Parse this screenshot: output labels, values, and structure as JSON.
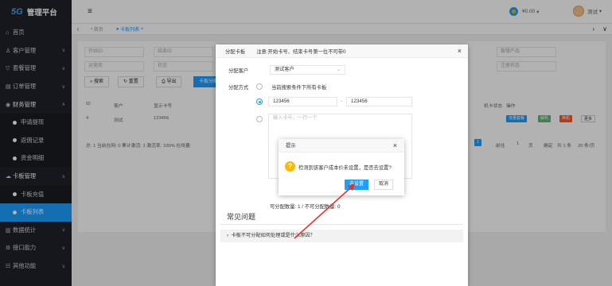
{
  "app": {
    "logo_mark": "5G",
    "title": "管理平台"
  },
  "sidebar": {
    "items": [
      {
        "icon": "home-icon",
        "label": "首页"
      },
      {
        "icon": "customer-icon",
        "label": "客户管理"
      },
      {
        "icon": "cart-icon",
        "label": "套餐管理"
      },
      {
        "icon": "order-icon",
        "label": "订单管理"
      },
      {
        "icon": "finance-icon",
        "label": "财务管理",
        "sub": [
          "申请提现",
          "返佣记录",
          "资金明细"
        ]
      },
      {
        "icon": "card-icon",
        "label": "卡板管理",
        "sub": [
          "卡板充值",
          "卡板列表"
        ]
      },
      {
        "icon": "stats-icon",
        "label": "数据统计"
      },
      {
        "icon": "api-icon",
        "label": "接口能力"
      },
      {
        "icon": "other-icon",
        "label": "其他功能"
      }
    ]
  },
  "header": {
    "menu_icon": "≡",
    "balance": "¥0.00",
    "balance_caret": "▾",
    "user": "测试",
    "user_caret": "▾"
  },
  "tabs": {
    "home": "首页",
    "current": "卡板列表"
  },
  "filters": {
    "row1": [
      "开始ID",
      "结束ID",
      "套餐产品",
      "注册状态"
    ],
    "row2": [
      "运营商",
      "状态"
    ],
    "search": "搜索",
    "reset": "重置",
    "export": "导出",
    "assign": "卡板分配"
  },
  "table": {
    "headers": [
      "ID",
      "客户",
      "显示卡号",
      "机卡状态",
      "操作"
    ],
    "row": {
      "id": "4",
      "customer": "测试",
      "card": "123456",
      "ops": [
        "流量套餐",
        "解机",
        "换机",
        "更多"
      ]
    }
  },
  "pager": {
    "text": "总: 1  当前在网: 0  累计激活: 1  激活率: 100%  在线量: ",
    "page": "1",
    "goto": "前往",
    "page_input": "1",
    "page_unit": "页",
    "confirm": "确定",
    "total": "共 1 条",
    "per_page": "20 条/页"
  },
  "modal1": {
    "title": "分配卡板",
    "note": "注意:开始卡号、结束卡号第一位不可带0",
    "customer_label": "分配客户",
    "customer_value": "测试客户",
    "method_label": "分配方式",
    "option1": "当前搜索条件下所有卡板",
    "start": "123456",
    "dash": "-",
    "end": "123456",
    "textarea_placeholder": "输入卡号，一行一个",
    "count_text": "可分配数量: 1 / 不可分配数量: 0",
    "faq_title": "常见问题",
    "faq_item": "卡板不可分配如何处理或是什么原因？"
  },
  "modal2": {
    "title": "提示",
    "message": "检测到该客户成本价未设置，是否去设置?",
    "ok": "去设置",
    "cancel": "取消"
  }
}
